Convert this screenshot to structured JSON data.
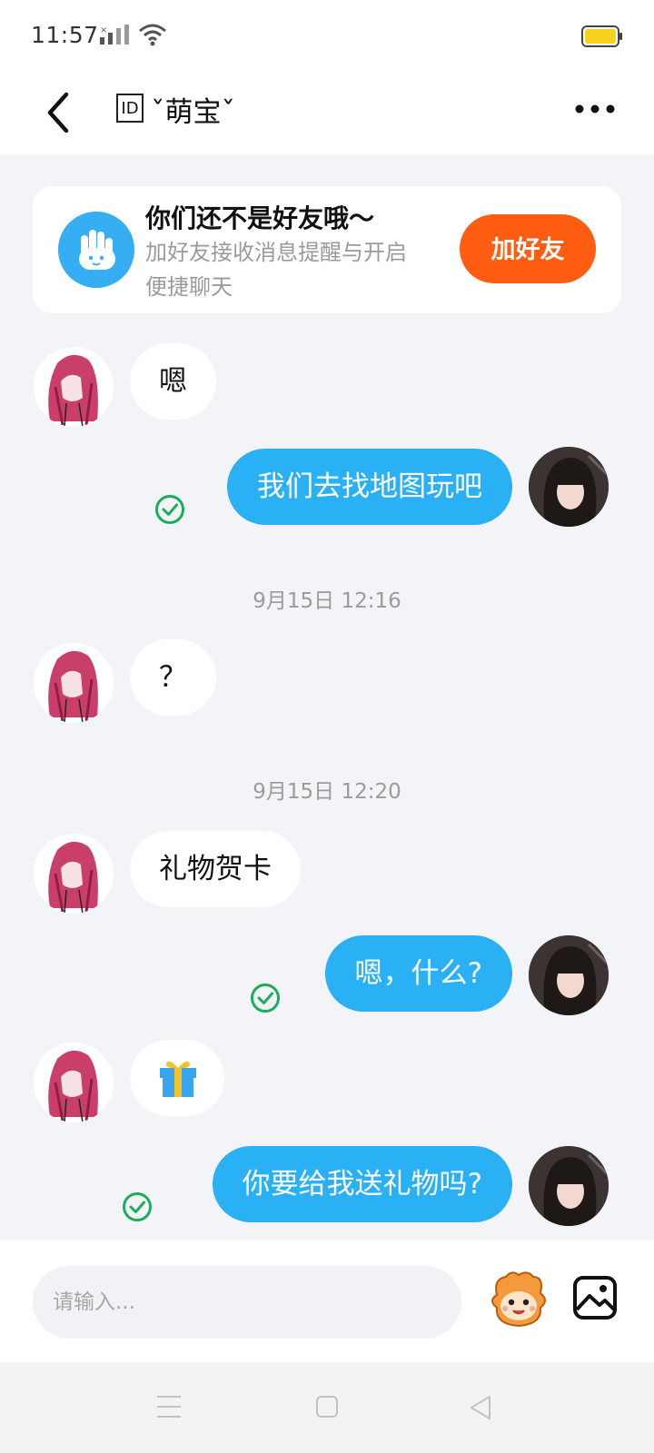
{
  "status_bar": {
    "time": "11:57",
    "battery_color": "#f7d21e"
  },
  "header": {
    "id_badge": "ID",
    "title": "ˇ萌宝ˇ"
  },
  "banner": {
    "title": "你们还不是好友哦～",
    "desc_line1": "加好友接收消息提醒与开启",
    "desc_line2": "便捷聊天",
    "button_label": "加好友",
    "button_color": "#fe5d12"
  },
  "messages": [
    {
      "from": "other",
      "text": "嗯"
    },
    {
      "from": "self",
      "text": "我们去找地图玩吧",
      "status": "read"
    },
    {
      "type": "timestamp",
      "text": "9月15日 12:16"
    },
    {
      "from": "other",
      "text": "？"
    },
    {
      "type": "timestamp",
      "text": "9月15日 12:20"
    },
    {
      "from": "other",
      "text": "礼物贺卡"
    },
    {
      "from": "self",
      "text": "嗯，什么?",
      "status": "read"
    },
    {
      "from": "other",
      "icon": "gift-icon"
    },
    {
      "from": "self",
      "text": "你要给我送礼物吗?",
      "status": "read"
    }
  ],
  "input": {
    "placeholder": "请输入..."
  },
  "colors": {
    "outgoing_bubble": "#2ab0f5",
    "read_check": "#1aad5a",
    "background": "#f3f4f8"
  },
  "icons": [
    "back-icon",
    "more-icon",
    "wave-hand-icon",
    "check-icon",
    "gift-icon",
    "emoji-mascot-icon",
    "image-icon",
    "nav-menu-icon",
    "nav-home-icon",
    "nav-back-icon"
  ]
}
